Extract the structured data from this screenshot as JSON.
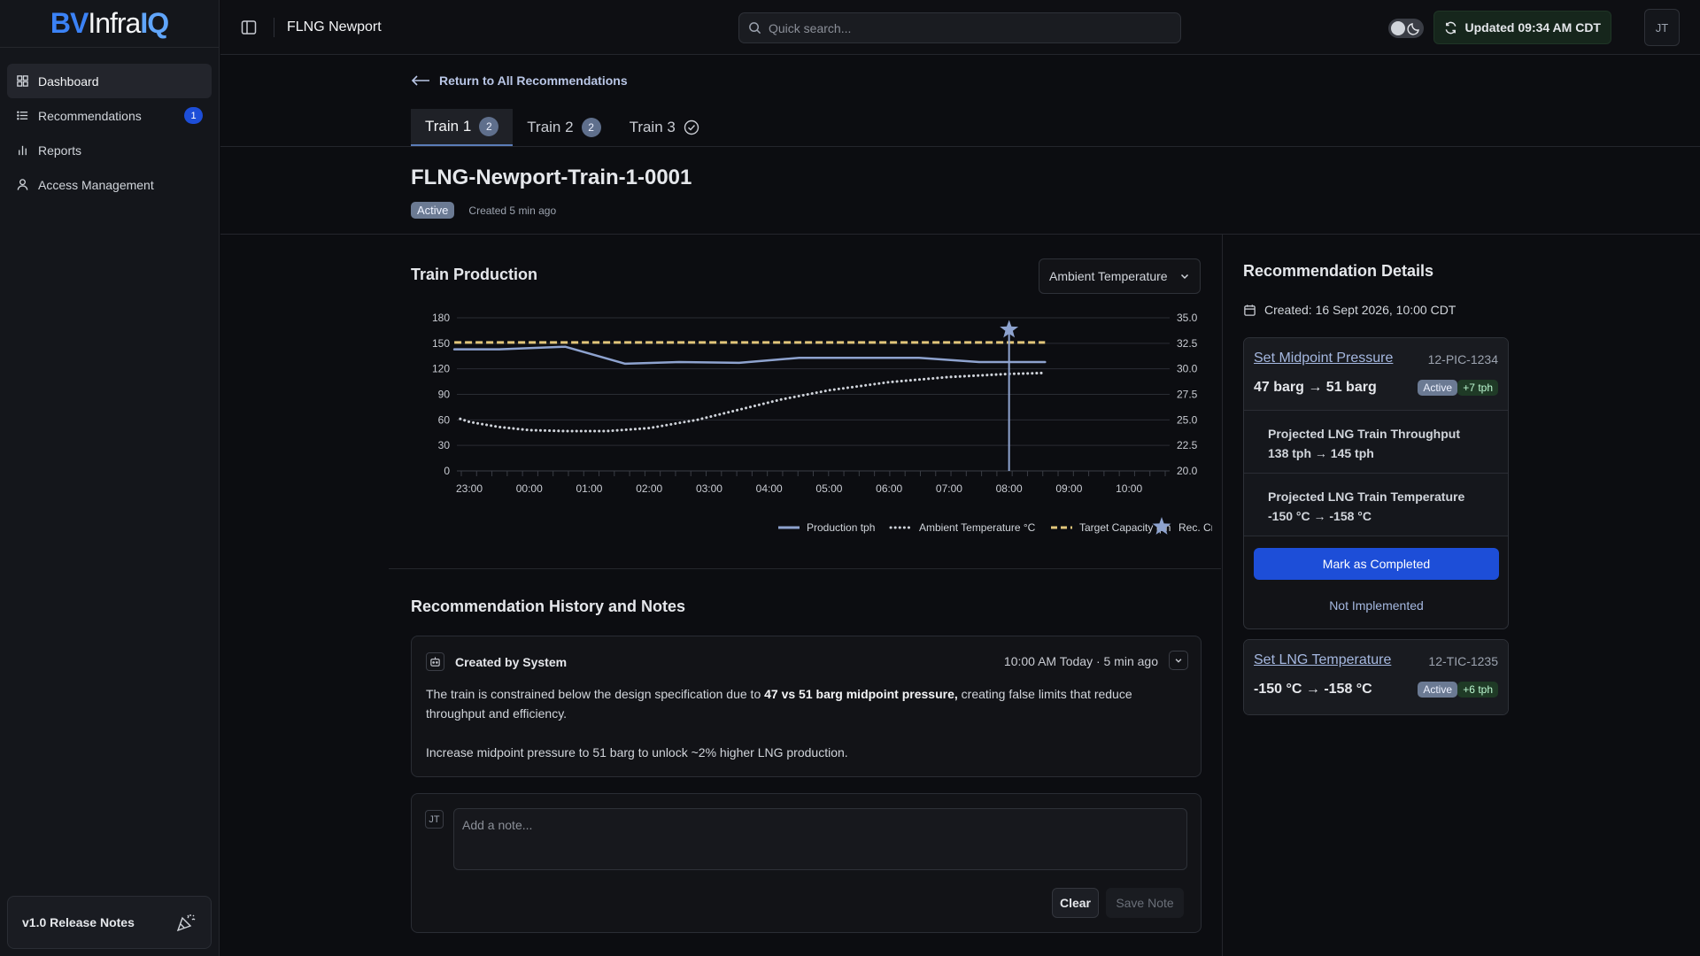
{
  "brand": {
    "part1": "BV",
    "part2": "Infra",
    "part3": "IQ"
  },
  "sidebar": {
    "items": [
      {
        "label": "Dashboard",
        "icon": "dashboard-icon"
      },
      {
        "label": "Recommendations",
        "icon": "list-icon",
        "badge": "1"
      },
      {
        "label": "Reports",
        "icon": "bar-chart-icon"
      },
      {
        "label": "Access Management",
        "icon": "user-icon"
      }
    ],
    "release_notes": "v1.0 Release Notes"
  },
  "header": {
    "site": "FLNG Newport",
    "search_placeholder": "Quick search...",
    "updated": "Updated 09:34 AM CDT",
    "avatar": "JT"
  },
  "page": {
    "back_link": "Return to All Recommendations",
    "tabs": [
      {
        "label": "Train 1",
        "count": "2",
        "active": true
      },
      {
        "label": "Train 2",
        "count": "2"
      },
      {
        "label": "Train 3",
        "status": "check-circle-icon"
      }
    ],
    "title": "FLNG-Newport-Train-1-0001",
    "status": "Active",
    "created_ago": "Created 5 min ago"
  },
  "chart_section": {
    "title": "Train Production",
    "selector": "Ambient Temperature"
  },
  "chart_data": {
    "type": "line",
    "x": [
      "23:00",
      "00:00",
      "01:00",
      "02:00",
      "03:00",
      "04:00",
      "05:00",
      "06:00",
      "07:00",
      "08:00",
      "09:00",
      "10:00"
    ],
    "y_left_ticks": [
      "180",
      "150",
      "120",
      "90",
      "60",
      "30",
      "0"
    ],
    "y_right_ticks": [
      "35.0",
      "32.5",
      "30.0",
      "27.5",
      "25.0",
      "22.5",
      "20.0"
    ],
    "ylim_left": [
      0,
      180
    ],
    "ylim_right": [
      20,
      35
    ],
    "series": [
      {
        "name": "Production tph",
        "axis": "left",
        "style": "solid",
        "color": "#8ea3cf",
        "points": [
          [
            -0.25,
            143
          ],
          [
            0,
            143
          ],
          [
            0.5,
            143
          ],
          [
            1.6,
            146
          ],
          [
            2.6,
            126
          ],
          [
            3.5,
            128
          ],
          [
            4.5,
            127
          ],
          [
            5.5,
            133
          ],
          [
            6.5,
            133
          ],
          [
            7.5,
            133
          ],
          [
            8.5,
            128
          ],
          [
            9.6,
            128
          ]
        ]
      },
      {
        "name": "Ambient Temperature °C",
        "axis": "right",
        "style": "dotted",
        "color": "#cfd3da",
        "points": [
          [
            -0.15,
            25.1
          ],
          [
            0,
            24.8
          ],
          [
            0.5,
            24.3
          ],
          [
            1,
            24.0
          ],
          [
            1.6,
            23.9
          ],
          [
            2.3,
            23.9
          ],
          [
            3,
            24.2
          ],
          [
            3.8,
            25.0
          ],
          [
            4.5,
            26.0
          ],
          [
            5.2,
            27.0
          ],
          [
            6,
            27.9
          ],
          [
            7,
            28.7
          ],
          [
            8,
            29.2
          ],
          [
            9,
            29.5
          ],
          [
            9.6,
            29.6
          ]
        ]
      },
      {
        "name": "Target Capacity tph",
        "axis": "left",
        "style": "dashed",
        "color": "#e2c67a",
        "points": [
          [
            -0.25,
            151
          ],
          [
            9.6,
            151
          ]
        ]
      }
    ],
    "marker": {
      "name": "Rec. Created",
      "x": 9.0,
      "y": 166
    },
    "grid": true,
    "legend_position": "bottom"
  },
  "history": {
    "title": "Recommendation History and Notes",
    "note": {
      "author": "Created by System",
      "time": "10:00 AM Today · 5 min ago",
      "p1_pre": "The train is constrained below the design specification due to ",
      "p1_bold": "47 vs 51 barg midpoint pressure,",
      "p1_post": " creating false limits that reduce throughput and efficiency.",
      "p2": "Increase midpoint pressure to 51 barg to unlock ~2% higher LNG production."
    },
    "compose": {
      "avatar": "JT",
      "placeholder": "Add a note...",
      "clear": "Clear",
      "save": "Save Note"
    }
  },
  "details": {
    "title": "Recommendation Details",
    "created": "Created: 16 Sept 2026, 10:00 CDT",
    "recs": [
      {
        "name": "Set Midpoint Pressure",
        "tag": "12-PIC-1234",
        "change": "47 barg → 51 barg",
        "status": "Active",
        "gain": "+7 tph",
        "proj1_label": "Projected LNG Train Throughput",
        "proj1_value": "138 tph → 145 tph",
        "proj2_label": "Projected LNG Train Temperature",
        "proj2_value": "-150 °C → -158 °C",
        "complete": "Mark as Completed",
        "not_impl": "Not Implemented"
      },
      {
        "name": "Set LNG Temperature",
        "tag": "12-TIC-1235",
        "change": "-150 °C → -158 °C",
        "status": "Active",
        "gain": "+6 tph"
      }
    ]
  }
}
